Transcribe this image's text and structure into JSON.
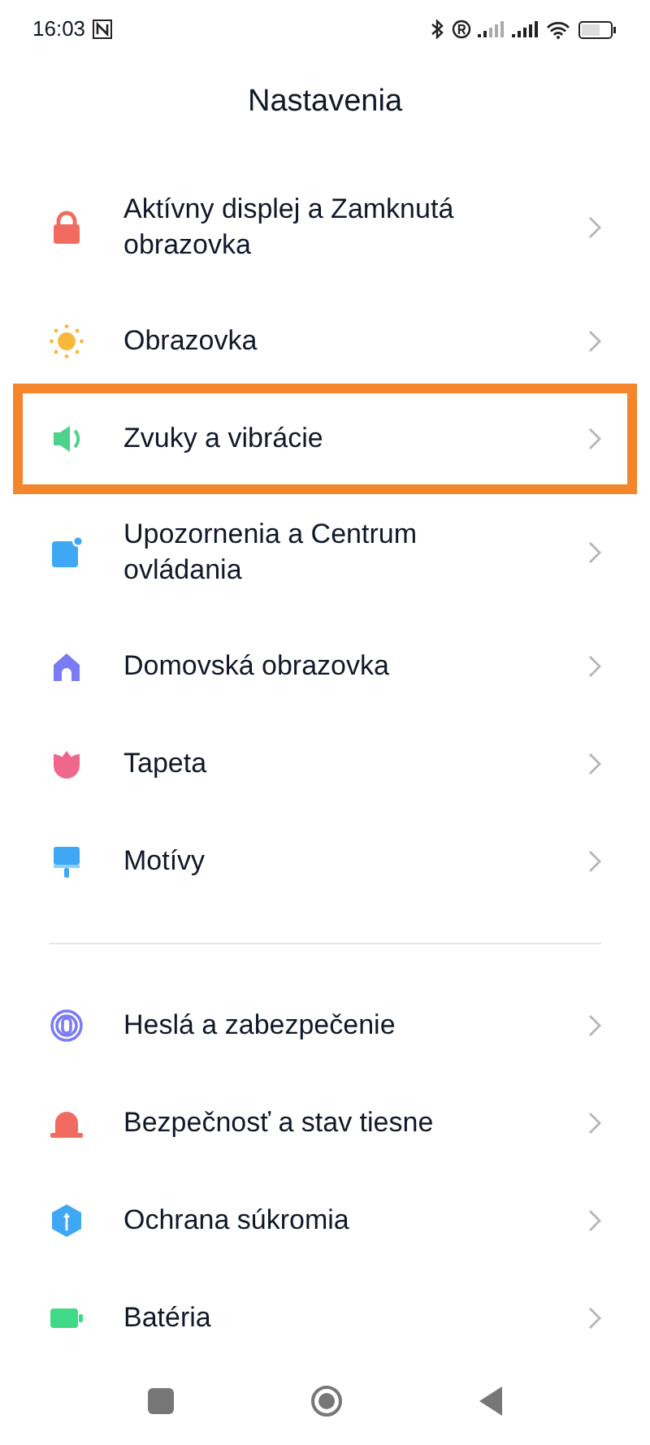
{
  "status_bar": {
    "time": "16:03"
  },
  "title": "Nastavenia",
  "sections": [
    {
      "items": [
        {
          "label": "Aktívny displej a Zamknutá obrazovka",
          "highlighted": false
        },
        {
          "label": "Obrazovka",
          "highlighted": false
        },
        {
          "label": "Zvuky a vibrácie",
          "highlighted": true
        },
        {
          "label": "Upozornenia a Centrum ovládania",
          "highlighted": false
        },
        {
          "label": "Domovská obrazovka",
          "highlighted": false
        },
        {
          "label": "Tapeta",
          "highlighted": false
        },
        {
          "label": "Motívy",
          "highlighted": false
        }
      ]
    },
    {
      "items": [
        {
          "label": "Heslá a zabezpečenie",
          "highlighted": false
        },
        {
          "label": "Bezpečnosť a stav tiesne",
          "highlighted": false
        },
        {
          "label": "Ochrana súkromia",
          "highlighted": false
        },
        {
          "label": "Batéria",
          "highlighted": false
        }
      ]
    }
  ]
}
